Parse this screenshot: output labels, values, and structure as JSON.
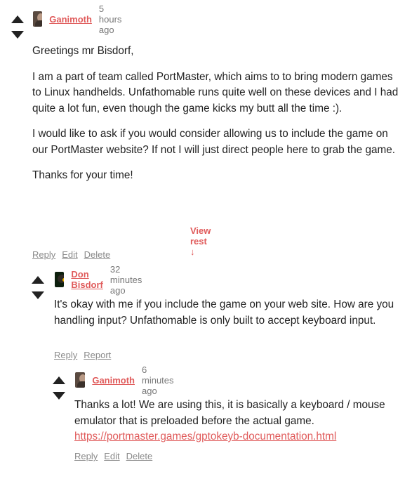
{
  "comments": [
    {
      "username": "Ganimoth",
      "time": "5 hours ago",
      "paragraphs": [
        "Greetings mr Bisdorf,",
        "I am a part of team called PortMaster, which aims to to bring modern games to Linux handhelds. Unfathomable runs quite well on these devices and I had quite a lot fun, even though the game kicks my butt all the time :).",
        "I would like to ask if you would consider allowing us to include the game on our PortMaster website? If not I will just direct people here to grab the game.",
        "Thanks for your time!"
      ],
      "view_rest": "View rest ↓",
      "actions": [
        "Reply",
        "Edit",
        "Delete"
      ]
    },
    {
      "username": "Don Bisdorf",
      "time": "32 minutes ago",
      "paragraphs": [
        "It's okay with me if you include the game on your web site. How are you handling input? Unfathomable is only built to accept keyboard input."
      ],
      "actions": [
        "Reply",
        "Report"
      ]
    },
    {
      "username": "Ganimoth",
      "time": "6 minutes ago",
      "text": "Thanks a lot! We are using this, it is basically a keyboard / mouse emulator that is preloaded before the actual game. ",
      "link": "https://portmaster.games/gptokeyb-documentation.html",
      "actions": [
        "Reply",
        "Edit",
        "Delete"
      ]
    }
  ]
}
